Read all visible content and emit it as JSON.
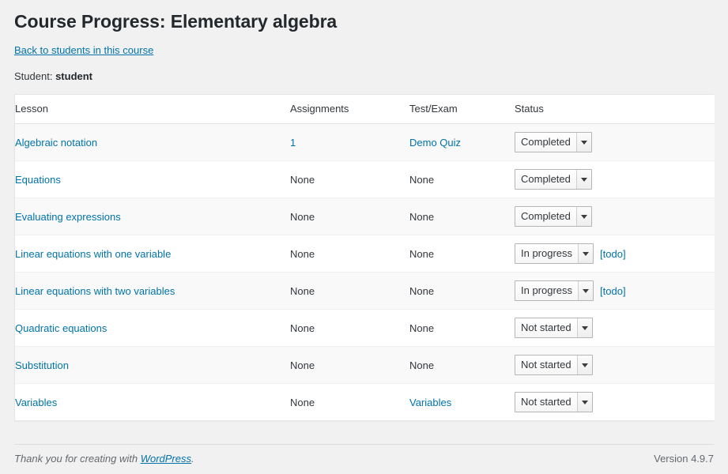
{
  "header": {
    "title": "Course Progress: Elementary algebra",
    "back_link": "Back to students in this course",
    "student_label": "Student:",
    "student_name": "student"
  },
  "table": {
    "columns": {
      "lesson": "Lesson",
      "assignments": "Assignments",
      "test": "Test/Exam",
      "status": "Status"
    },
    "rows": [
      {
        "lesson": "Algebraic notation",
        "lesson_is_link": true,
        "assignments": "1",
        "assignments_is_link": true,
        "test": "Demo Quiz",
        "test_is_link": true,
        "status": "Completed",
        "todo": ""
      },
      {
        "lesson": "Equations",
        "lesson_is_link": true,
        "assignments": "None",
        "assignments_is_link": false,
        "test": "None",
        "test_is_link": false,
        "status": "Completed",
        "todo": ""
      },
      {
        "lesson": "Evaluating expressions",
        "lesson_is_link": true,
        "assignments": "None",
        "assignments_is_link": false,
        "test": "None",
        "test_is_link": false,
        "status": "Completed",
        "todo": ""
      },
      {
        "lesson": "Linear equations with one variable",
        "lesson_is_link": true,
        "assignments": "None",
        "assignments_is_link": false,
        "test": "None",
        "test_is_link": false,
        "status": "In progress",
        "todo": "[todo]"
      },
      {
        "lesson": "Linear equations with two variables",
        "lesson_is_link": true,
        "assignments": "None",
        "assignments_is_link": false,
        "test": "None",
        "test_is_link": false,
        "status": "In progress",
        "todo": "[todo]"
      },
      {
        "lesson": "Quadratic equations",
        "lesson_is_link": true,
        "assignments": "None",
        "assignments_is_link": false,
        "test": "None",
        "test_is_link": false,
        "status": "Not started",
        "todo": ""
      },
      {
        "lesson": "Substitution",
        "lesson_is_link": true,
        "assignments": "None",
        "assignments_is_link": false,
        "test": "None",
        "test_is_link": false,
        "status": "Not started",
        "todo": ""
      },
      {
        "lesson": "Variables",
        "lesson_is_link": true,
        "assignments": "None",
        "assignments_is_link": false,
        "test": "Variables",
        "test_is_link": true,
        "status": "Not started",
        "todo": ""
      }
    ],
    "status_options": [
      "Not started",
      "In progress",
      "Completed"
    ]
  },
  "footer": {
    "thanks_prefix": "Thank you for creating with ",
    "wordpress_link": "WordPress",
    "thanks_suffix": ".",
    "version": "Version 4.9.7"
  },
  "colors": {
    "link": "#0073aa",
    "page_background": "#f1f1f1",
    "table_background": "#ffffff",
    "row_alt_background": "#f9f9f9",
    "title_text": "#23282d"
  }
}
